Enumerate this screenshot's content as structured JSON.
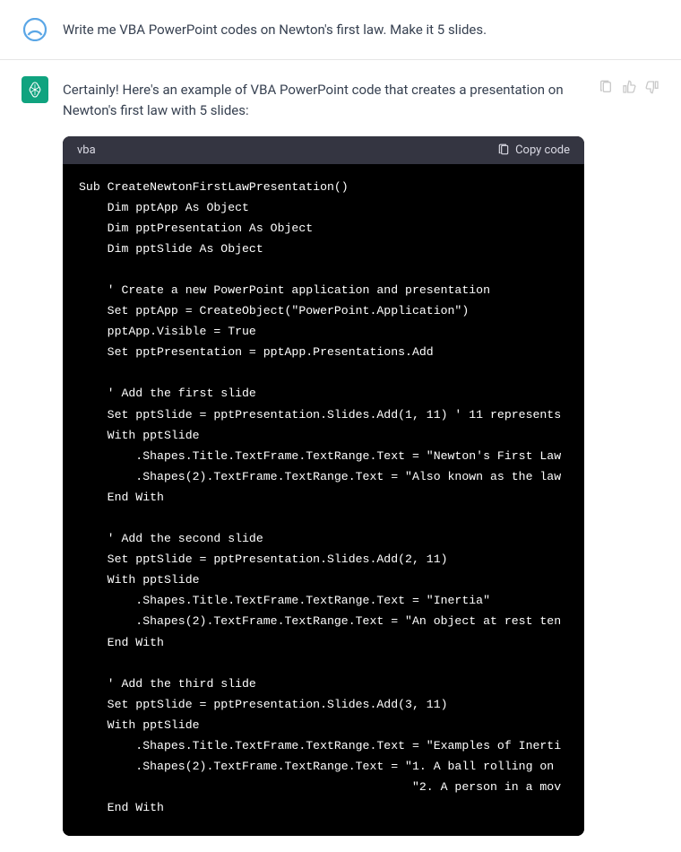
{
  "user_message": "Write me VBA PowerPoint codes on Newton's first law. Make it 5 slides.",
  "assistant_message": "Certainly! Here's an example of VBA PowerPoint code that creates a presentation on Newton's first law with 5 slides:",
  "code_block": {
    "language": "vba",
    "copy_label": "Copy code",
    "content": "Sub CreateNewtonFirstLawPresentation()\n    Dim pptApp As Object\n    Dim pptPresentation As Object\n    Dim pptSlide As Object\n\n    ' Create a new PowerPoint application and presentation\n    Set pptApp = CreateObject(\"PowerPoint.Application\")\n    pptApp.Visible = True\n    Set pptPresentation = pptApp.Presentations.Add\n\n    ' Add the first slide\n    Set pptSlide = pptPresentation.Slides.Add(1, 11) ' 11 represents\n    With pptSlide\n        .Shapes.Title.TextFrame.TextRange.Text = \"Newton's First Law\n        .Shapes(2).TextFrame.TextRange.Text = \"Also known as the law\n    End With\n\n    ' Add the second slide\n    Set pptSlide = pptPresentation.Slides.Add(2, 11)\n    With pptSlide\n        .Shapes.Title.TextFrame.TextRange.Text = \"Inertia\"\n        .Shapes(2).TextFrame.TextRange.Text = \"An object at rest ten\n    End With\n\n    ' Add the third slide\n    Set pptSlide = pptPresentation.Slides.Add(3, 11)\n    With pptSlide\n        .Shapes.Title.TextFrame.TextRange.Text = \"Examples of Inerti\n        .Shapes(2).TextFrame.TextRange.Text = \"1. A ball rolling on \n                                               \"2. A person in a mov\n    End With"
  }
}
